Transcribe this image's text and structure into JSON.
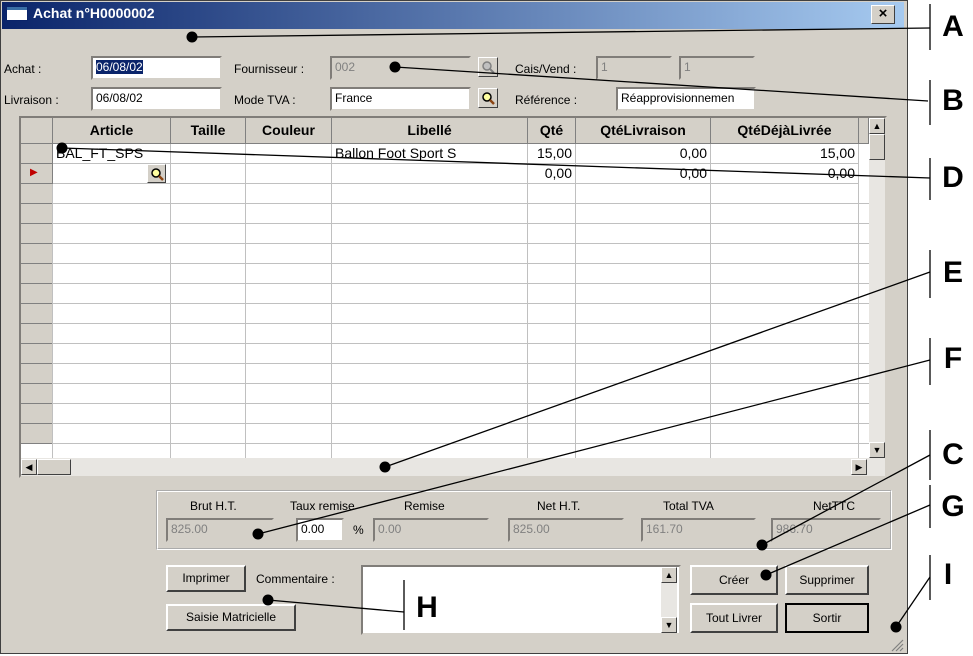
{
  "window": {
    "title": "Achat n°H0000002",
    "close_glyph": "×"
  },
  "form": {
    "achat_label": "Achat :",
    "achat_value": "06/08/02",
    "livraison_label": "Livraison :",
    "livraison_value": "06/08/02",
    "fournisseur_label": "Fournisseur :",
    "fournisseur_value": "002",
    "mode_tva_label": "Mode TVA :",
    "mode_tva_value": "France",
    "cais_vend_label": "Cais/Vend :",
    "cais_value": "1",
    "vend_value": "1",
    "reference_label": "Référence :",
    "reference_value": "Réapprovisionnemen"
  },
  "grid": {
    "columns": [
      "Article",
      "Taille",
      "Couleur",
      "Libellé",
      "Qté",
      "QtéLivraison",
      "QtéDéjàLivrée"
    ],
    "rows": [
      {
        "article": "BAL_FT_SPS",
        "taille": "",
        "couleur": "",
        "libelle": "Ballon Foot Sport S",
        "qte": "15,00",
        "qte_livraison": "0,00",
        "qte_deja": "15,00"
      },
      {
        "article": "",
        "taille": "",
        "couleur": "",
        "libelle": "",
        "qte": "0,00",
        "qte_livraison": "0,00",
        "qte_deja": "0,00"
      }
    ],
    "current_row_marker": "▶"
  },
  "totals": {
    "brut_ht_label": "Brut H.T.",
    "brut_ht_value": "825.00",
    "taux_remise_label": "Taux remise",
    "taux_remise_value": "0.00",
    "percent_sign": "%",
    "remise_label": "Remise",
    "remise_value": "0.00",
    "net_ht_label": "Net H.T.",
    "net_ht_value": "825.00",
    "total_tva_label": "Total TVA",
    "total_tva_value": "161.70",
    "net_ttc_label": "NetTTC",
    "net_ttc_value": "986.70"
  },
  "buttons": {
    "imprimer": "Imprimer",
    "saisie_matricielle": "Saisie Matricielle",
    "commentaire_label": "Commentaire :",
    "creer": "Créer",
    "supprimer": "Supprimer",
    "tout_livrer": "Tout Livrer",
    "sortir": "Sortir"
  },
  "callouts": [
    "A",
    "B",
    "C",
    "D",
    "E",
    "F",
    "G",
    "H",
    "I"
  ]
}
